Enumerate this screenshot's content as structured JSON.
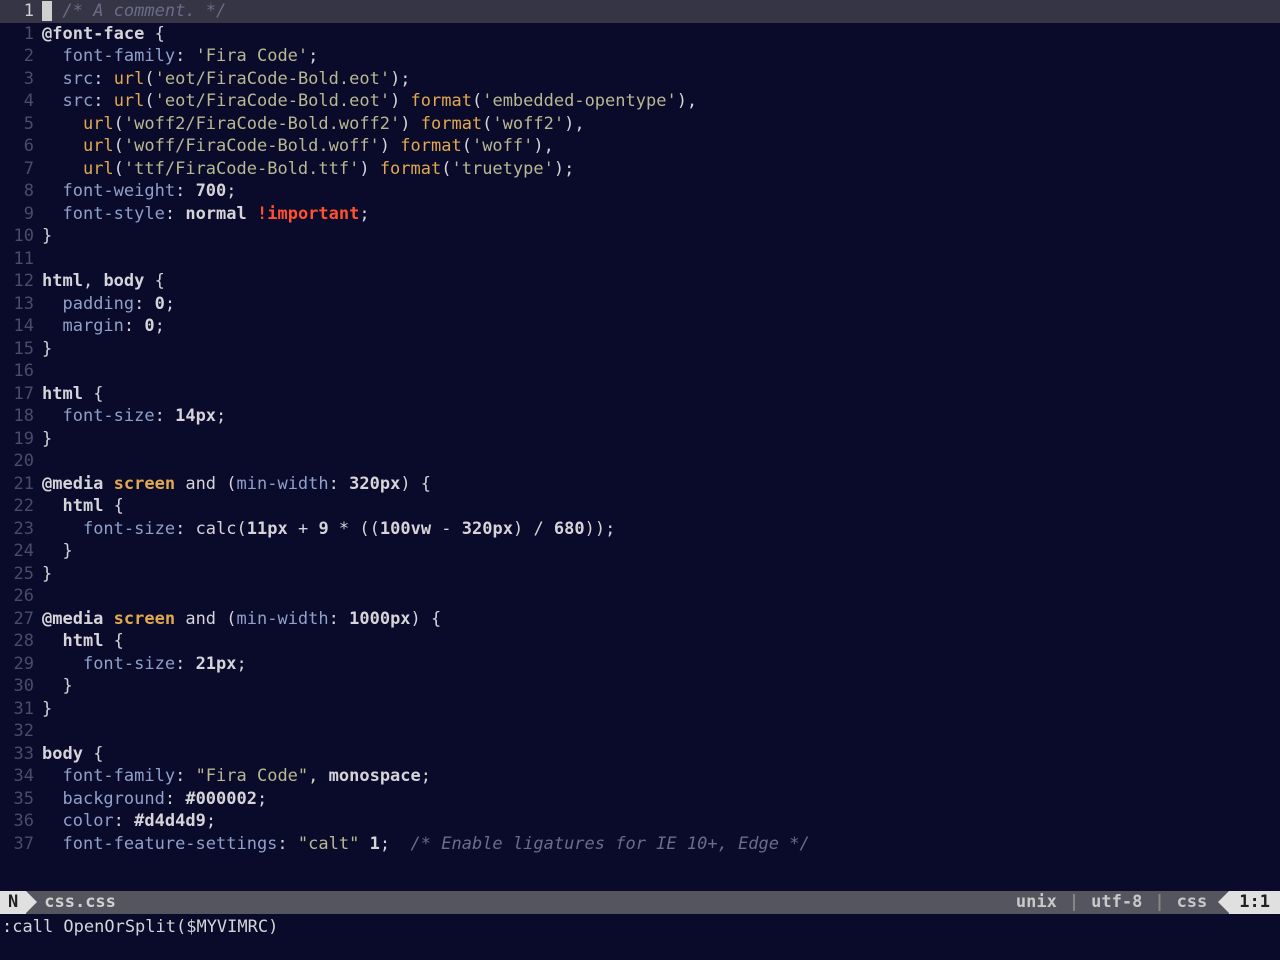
{
  "status": {
    "mode": "N",
    "filename": "css.css",
    "fileformat": "unix",
    "encoding": "utf-8",
    "filetype": "css",
    "position": "1:1"
  },
  "cmdline": ":call OpenOrSplit($MYVIMRC)",
  "cursor_line": 1,
  "lines": [
    {
      "n": 1,
      "tokens": [
        {
          "t": "  ",
          "cls": "c-text"
        },
        {
          "t": "/* A comment. */",
          "cls": "c-comment"
        }
      ]
    },
    {
      "n": 1,
      "tokens": [
        {
          "t": "@font-face",
          "cls": "c-atkey"
        },
        {
          "t": " {",
          "cls": "c-punct"
        }
      ]
    },
    {
      "n": 2,
      "tokens": [
        {
          "t": "  ",
          "cls": "c-text"
        },
        {
          "t": "font-family",
          "cls": "c-prop"
        },
        {
          "t": ": ",
          "cls": "c-punct"
        },
        {
          "t": "'Fira Code'",
          "cls": "c-string"
        },
        {
          "t": ";",
          "cls": "c-punct"
        }
      ]
    },
    {
      "n": 3,
      "tokens": [
        {
          "t": "  ",
          "cls": "c-text"
        },
        {
          "t": "src",
          "cls": "c-prop"
        },
        {
          "t": ": ",
          "cls": "c-punct"
        },
        {
          "t": "url",
          "cls": "c-func"
        },
        {
          "t": "(",
          "cls": "c-punct"
        },
        {
          "t": "'eot/FiraCode-Bold.eot'",
          "cls": "c-string"
        },
        {
          "t": ");",
          "cls": "c-punct"
        }
      ]
    },
    {
      "n": 4,
      "tokens": [
        {
          "t": "  ",
          "cls": "c-text"
        },
        {
          "t": "src",
          "cls": "c-prop"
        },
        {
          "t": ": ",
          "cls": "c-punct"
        },
        {
          "t": "url",
          "cls": "c-func"
        },
        {
          "t": "(",
          "cls": "c-punct"
        },
        {
          "t": "'eot/FiraCode-Bold.eot'",
          "cls": "c-string"
        },
        {
          "t": ") ",
          "cls": "c-punct"
        },
        {
          "t": "format",
          "cls": "c-func"
        },
        {
          "t": "(",
          "cls": "c-punct"
        },
        {
          "t": "'embedded-opentype'",
          "cls": "c-string"
        },
        {
          "t": "),",
          "cls": "c-punct"
        }
      ]
    },
    {
      "n": 5,
      "tokens": [
        {
          "t": "    ",
          "cls": "c-text"
        },
        {
          "t": "url",
          "cls": "c-func"
        },
        {
          "t": "(",
          "cls": "c-punct"
        },
        {
          "t": "'woff2/FiraCode-Bold.woff2'",
          "cls": "c-string"
        },
        {
          "t": ") ",
          "cls": "c-punct"
        },
        {
          "t": "format",
          "cls": "c-func"
        },
        {
          "t": "(",
          "cls": "c-punct"
        },
        {
          "t": "'woff2'",
          "cls": "c-string"
        },
        {
          "t": "),",
          "cls": "c-punct"
        }
      ]
    },
    {
      "n": 6,
      "tokens": [
        {
          "t": "    ",
          "cls": "c-text"
        },
        {
          "t": "url",
          "cls": "c-func"
        },
        {
          "t": "(",
          "cls": "c-punct"
        },
        {
          "t": "'woff/FiraCode-Bold.woff'",
          "cls": "c-string"
        },
        {
          "t": ") ",
          "cls": "c-punct"
        },
        {
          "t": "format",
          "cls": "c-func"
        },
        {
          "t": "(",
          "cls": "c-punct"
        },
        {
          "t": "'woff'",
          "cls": "c-string"
        },
        {
          "t": "),",
          "cls": "c-punct"
        }
      ]
    },
    {
      "n": 7,
      "tokens": [
        {
          "t": "    ",
          "cls": "c-text"
        },
        {
          "t": "url",
          "cls": "c-func"
        },
        {
          "t": "(",
          "cls": "c-punct"
        },
        {
          "t": "'ttf/FiraCode-Bold.ttf'",
          "cls": "c-string"
        },
        {
          "t": ") ",
          "cls": "c-punct"
        },
        {
          "t": "format",
          "cls": "c-func"
        },
        {
          "t": "(",
          "cls": "c-punct"
        },
        {
          "t": "'truetype'",
          "cls": "c-string"
        },
        {
          "t": ");",
          "cls": "c-punct"
        }
      ]
    },
    {
      "n": 8,
      "tokens": [
        {
          "t": "  ",
          "cls": "c-text"
        },
        {
          "t": "font-weight",
          "cls": "c-prop"
        },
        {
          "t": ": ",
          "cls": "c-punct"
        },
        {
          "t": "700",
          "cls": "c-number"
        },
        {
          "t": ";",
          "cls": "c-punct"
        }
      ]
    },
    {
      "n": 9,
      "tokens": [
        {
          "t": "  ",
          "cls": "c-text"
        },
        {
          "t": "font-style",
          "cls": "c-prop"
        },
        {
          "t": ": ",
          "cls": "c-punct"
        },
        {
          "t": "normal",
          "cls": "c-number"
        },
        {
          "t": " ",
          "cls": "c-text"
        },
        {
          "t": "!important",
          "cls": "c-important"
        },
        {
          "t": ";",
          "cls": "c-punct"
        }
      ]
    },
    {
      "n": 10,
      "tokens": [
        {
          "t": "}",
          "cls": "c-punct"
        }
      ]
    },
    {
      "n": 11,
      "tokens": [
        {
          "t": "",
          "cls": "c-text"
        }
      ]
    },
    {
      "n": 12,
      "tokens": [
        {
          "t": "html",
          "cls": "c-sel"
        },
        {
          "t": ", ",
          "cls": "c-punct"
        },
        {
          "t": "body",
          "cls": "c-sel"
        },
        {
          "t": " {",
          "cls": "c-punct"
        }
      ]
    },
    {
      "n": 13,
      "tokens": [
        {
          "t": "  ",
          "cls": "c-text"
        },
        {
          "t": "padding",
          "cls": "c-prop"
        },
        {
          "t": ": ",
          "cls": "c-punct"
        },
        {
          "t": "0",
          "cls": "c-number"
        },
        {
          "t": ";",
          "cls": "c-punct"
        }
      ]
    },
    {
      "n": 14,
      "tokens": [
        {
          "t": "  ",
          "cls": "c-text"
        },
        {
          "t": "margin",
          "cls": "c-prop"
        },
        {
          "t": ": ",
          "cls": "c-punct"
        },
        {
          "t": "0",
          "cls": "c-number"
        },
        {
          "t": ";",
          "cls": "c-punct"
        }
      ]
    },
    {
      "n": 15,
      "tokens": [
        {
          "t": "}",
          "cls": "c-punct"
        }
      ]
    },
    {
      "n": 16,
      "tokens": [
        {
          "t": "",
          "cls": "c-text"
        }
      ]
    },
    {
      "n": 17,
      "tokens": [
        {
          "t": "html",
          "cls": "c-sel"
        },
        {
          "t": " {",
          "cls": "c-punct"
        }
      ]
    },
    {
      "n": 18,
      "tokens": [
        {
          "t": "  ",
          "cls": "c-text"
        },
        {
          "t": "font-size",
          "cls": "c-prop"
        },
        {
          "t": ": ",
          "cls": "c-punct"
        },
        {
          "t": "14px",
          "cls": "c-number"
        },
        {
          "t": ";",
          "cls": "c-punct"
        }
      ]
    },
    {
      "n": 19,
      "tokens": [
        {
          "t": "}",
          "cls": "c-punct"
        }
      ]
    },
    {
      "n": 20,
      "tokens": [
        {
          "t": "",
          "cls": "c-text"
        }
      ]
    },
    {
      "n": 21,
      "tokens": [
        {
          "t": "@media",
          "cls": "c-atkey"
        },
        {
          "t": " ",
          "cls": "c-text"
        },
        {
          "t": "screen",
          "cls": "c-media"
        },
        {
          "t": " and (",
          "cls": "c-text"
        },
        {
          "t": "min-width",
          "cls": "c-prop"
        },
        {
          "t": ": ",
          "cls": "c-punct"
        },
        {
          "t": "320px",
          "cls": "c-number"
        },
        {
          "t": ") {",
          "cls": "c-punct"
        }
      ]
    },
    {
      "n": 22,
      "tokens": [
        {
          "t": "  ",
          "cls": "c-text"
        },
        {
          "t": "html",
          "cls": "c-sel"
        },
        {
          "t": " {",
          "cls": "c-punct"
        }
      ]
    },
    {
      "n": 23,
      "tokens": [
        {
          "t": "    ",
          "cls": "c-text"
        },
        {
          "t": "font-size",
          "cls": "c-prop"
        },
        {
          "t": ": ",
          "cls": "c-punct"
        },
        {
          "t": "calc",
          "cls": "c-text"
        },
        {
          "t": "(",
          "cls": "c-punct"
        },
        {
          "t": "11px",
          "cls": "c-number"
        },
        {
          "t": " + ",
          "cls": "c-text"
        },
        {
          "t": "9",
          "cls": "c-number"
        },
        {
          "t": " * ((",
          "cls": "c-text"
        },
        {
          "t": "100vw",
          "cls": "c-number"
        },
        {
          "t": " - ",
          "cls": "c-text"
        },
        {
          "t": "320px",
          "cls": "c-number"
        },
        {
          "t": ") / ",
          "cls": "c-text"
        },
        {
          "t": "680",
          "cls": "c-number"
        },
        {
          "t": "));",
          "cls": "c-punct"
        }
      ]
    },
    {
      "n": 24,
      "tokens": [
        {
          "t": "  }",
          "cls": "c-punct"
        }
      ]
    },
    {
      "n": 25,
      "tokens": [
        {
          "t": "}",
          "cls": "c-punct"
        }
      ]
    },
    {
      "n": 26,
      "tokens": [
        {
          "t": "",
          "cls": "c-text"
        }
      ]
    },
    {
      "n": 27,
      "tokens": [
        {
          "t": "@media",
          "cls": "c-atkey"
        },
        {
          "t": " ",
          "cls": "c-text"
        },
        {
          "t": "screen",
          "cls": "c-media"
        },
        {
          "t": " and (",
          "cls": "c-text"
        },
        {
          "t": "min-width",
          "cls": "c-prop"
        },
        {
          "t": ": ",
          "cls": "c-punct"
        },
        {
          "t": "1000px",
          "cls": "c-number"
        },
        {
          "t": ") {",
          "cls": "c-punct"
        }
      ]
    },
    {
      "n": 28,
      "tokens": [
        {
          "t": "  ",
          "cls": "c-text"
        },
        {
          "t": "html",
          "cls": "c-sel"
        },
        {
          "t": " {",
          "cls": "c-punct"
        }
      ]
    },
    {
      "n": 29,
      "tokens": [
        {
          "t": "    ",
          "cls": "c-text"
        },
        {
          "t": "font-size",
          "cls": "c-prop"
        },
        {
          "t": ": ",
          "cls": "c-punct"
        },
        {
          "t": "21px",
          "cls": "c-number"
        },
        {
          "t": ";",
          "cls": "c-punct"
        }
      ]
    },
    {
      "n": 30,
      "tokens": [
        {
          "t": "  }",
          "cls": "c-punct"
        }
      ]
    },
    {
      "n": 31,
      "tokens": [
        {
          "t": "}",
          "cls": "c-punct"
        }
      ]
    },
    {
      "n": 32,
      "tokens": [
        {
          "t": "",
          "cls": "c-text"
        }
      ]
    },
    {
      "n": 33,
      "tokens": [
        {
          "t": "body",
          "cls": "c-sel"
        },
        {
          "t": " {",
          "cls": "c-punct"
        }
      ]
    },
    {
      "n": 34,
      "tokens": [
        {
          "t": "  ",
          "cls": "c-text"
        },
        {
          "t": "font-family",
          "cls": "c-prop"
        },
        {
          "t": ": ",
          "cls": "c-punct"
        },
        {
          "t": "\"Fira Code\"",
          "cls": "c-string"
        },
        {
          "t": ", ",
          "cls": "c-punct"
        },
        {
          "t": "monospace",
          "cls": "c-number"
        },
        {
          "t": ";",
          "cls": "c-punct"
        }
      ]
    },
    {
      "n": 35,
      "tokens": [
        {
          "t": "  ",
          "cls": "c-text"
        },
        {
          "t": "background",
          "cls": "c-prop"
        },
        {
          "t": ": ",
          "cls": "c-punct"
        },
        {
          "t": "#000002",
          "cls": "c-number"
        },
        {
          "t": ";",
          "cls": "c-punct"
        }
      ]
    },
    {
      "n": 36,
      "tokens": [
        {
          "t": "  ",
          "cls": "c-text"
        },
        {
          "t": "color",
          "cls": "c-prop"
        },
        {
          "t": ": ",
          "cls": "c-punct"
        },
        {
          "t": "#d4d4d9",
          "cls": "c-number"
        },
        {
          "t": ";",
          "cls": "c-punct"
        }
      ]
    },
    {
      "n": 37,
      "tokens": [
        {
          "t": "  ",
          "cls": "c-text"
        },
        {
          "t": "font-feature-settings",
          "cls": "c-prop"
        },
        {
          "t": ": ",
          "cls": "c-punct"
        },
        {
          "t": "\"calt\"",
          "cls": "c-string"
        },
        {
          "t": " ",
          "cls": "c-text"
        },
        {
          "t": "1",
          "cls": "c-number"
        },
        {
          "t": ";  ",
          "cls": "c-punct"
        },
        {
          "t": "/* Enable ligatures for IE 10+, Edge */",
          "cls": "c-comment"
        }
      ]
    }
  ]
}
